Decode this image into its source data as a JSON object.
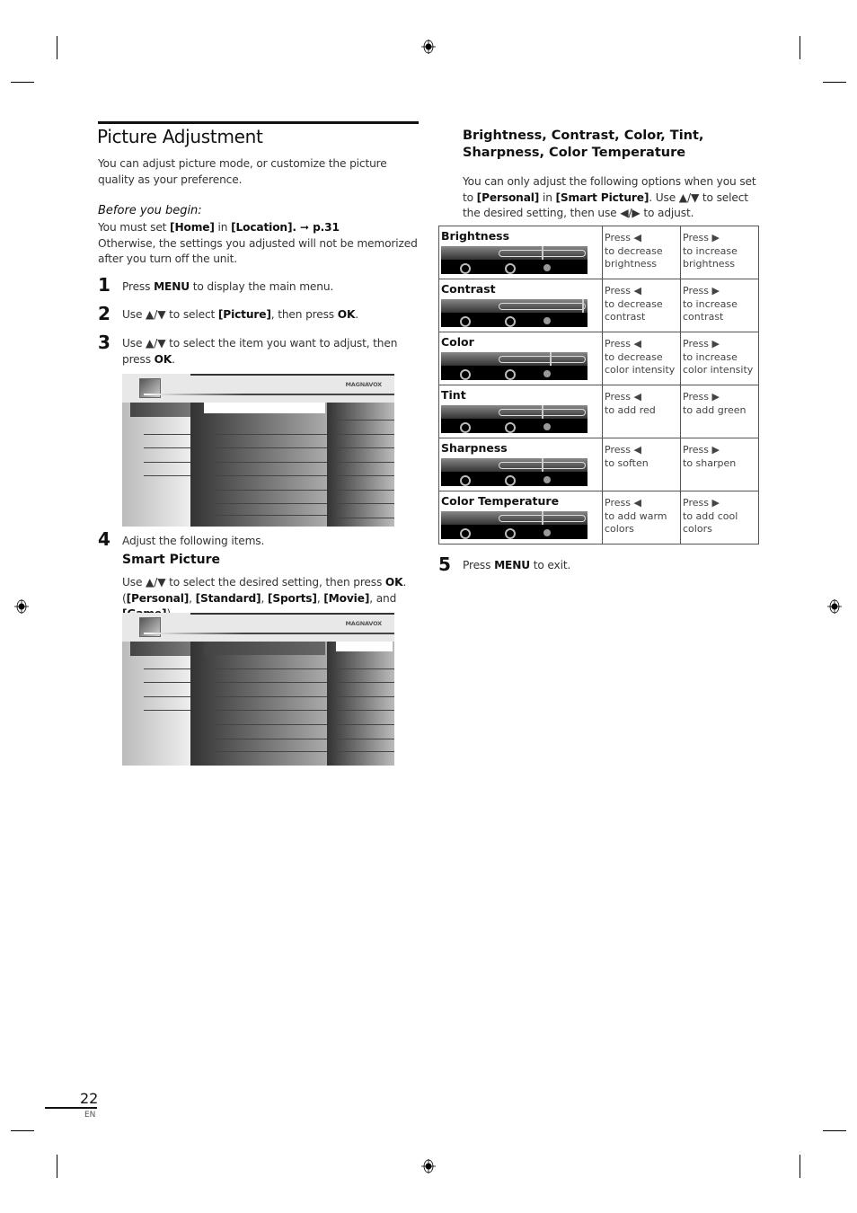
{
  "page": {
    "title": "Picture Adjustment",
    "intro": "You can adjust picture mode, or customize the picture quality as your preference.",
    "before_heading": "Before you begin:",
    "before_line1_prefix": "You must set ",
    "before_line1_home": "[Home]",
    "before_line1_in": " in ",
    "before_line1_location": "[Location]",
    "before_line1_ref": ". ➞ p.31",
    "before_line2": "Otherwise, the settings you adjusted will not be memorized after you turn off the unit.",
    "page_number": "22",
    "lang": "EN"
  },
  "steps": [
    {
      "num": "1",
      "pre": "Press ",
      "key": "MENU",
      "post": " to display the main menu."
    },
    {
      "num": "2",
      "pre": "Use ▲/▼ to select ",
      "key": "[Picture]",
      "mid": ", then press ",
      "key2": "OK",
      "post": "."
    },
    {
      "num": "3",
      "pre": "Use ▲/▼ to select the item you want to adjust, then press ",
      "key": "OK",
      "post": "."
    },
    {
      "num": "4",
      "text": "Adjust the following items."
    },
    {
      "num": "5",
      "pre": "Press ",
      "key": "MENU",
      "post": " to exit."
    }
  ],
  "menu_screen": {
    "brand": "MAGNAVOX"
  },
  "smart_picture": {
    "heading": "Smart Picture",
    "line1_pre": "Use ▲/▼ to select the desired setting, then press ",
    "line1_key": "OK",
    "line1_post": ".",
    "options": [
      "[Personal]",
      "[Standard]",
      "[Sports]",
      "[Movie]",
      "[Game]"
    ],
    "and_word": "and"
  },
  "adjust_section": {
    "heading_line1": "Brightness, Contrast, Color, Tint,",
    "heading_line2": "Sharpness, Color Temperature",
    "desc_pre": "You can only adjust the following options when you set to ",
    "desc_personal": "[Personal]",
    "desc_in": " in ",
    "desc_smart": "[Smart Picture]",
    "desc_post": ". Use ▲/▼ to select the desired setting, then use ◀/▶ to adjust.",
    "rows": [
      {
        "label": "Brightness",
        "level": 0.5,
        "dec_press": "Press ◀",
        "dec_text": "to decrease brightness",
        "inc_press": "Press ▶",
        "inc_text": "to increase brightness"
      },
      {
        "label": "Contrast",
        "level": 0.98,
        "dec_press": "Press ◀",
        "dec_text": "to decrease contrast",
        "inc_press": "Press ▶",
        "inc_text": "to increase contrast"
      },
      {
        "label": "Color",
        "level": 0.6,
        "dec_press": "Press ◀",
        "dec_text": "to decrease color intensity",
        "inc_press": "Press ▶",
        "inc_text": "to increase color intensity"
      },
      {
        "label": "Tint",
        "level": 0.5,
        "dec_press": "Press ◀",
        "dec_text": "to add red",
        "inc_press": "Press ▶",
        "inc_text": "to add green"
      },
      {
        "label": "Sharpness",
        "level": 0.5,
        "dec_press": "Press ◀",
        "dec_text": "to soften",
        "inc_press": "Press ▶",
        "inc_text": "to sharpen"
      },
      {
        "label": "Color Temperature",
        "level": 0.5,
        "dec_press": "Press ◀",
        "dec_text": "to add warm colors",
        "inc_press": "Press ▶",
        "inc_text": "to add cool colors"
      }
    ]
  }
}
